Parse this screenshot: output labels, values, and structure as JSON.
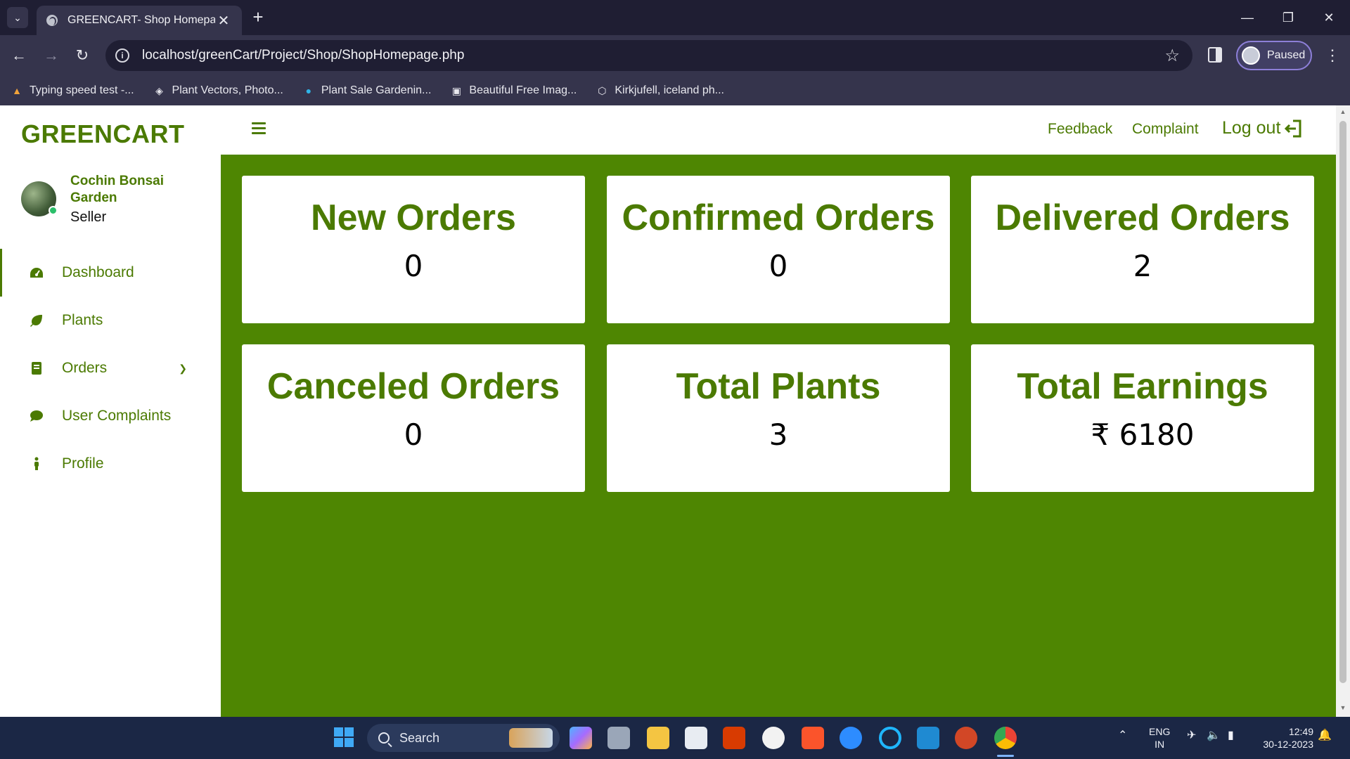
{
  "browser": {
    "tab_title": "GREENCART- Shop Homepage",
    "url": "localhost/greenCart/Project/Shop/ShopHomepage.php",
    "profile_label": "Paused",
    "bookmarks": [
      {
        "label": "Typing speed test -...",
        "icon": "typing-test-icon"
      },
      {
        "label": "Plant Vectors, Photo...",
        "icon": "freepik-icon"
      },
      {
        "label": "Plant Sale Gardenin...",
        "icon": "canva-icon"
      },
      {
        "label": "Beautiful Free Imag...",
        "icon": "unsplash-icon"
      },
      {
        "label": "Kirkjufell, iceland ph...",
        "icon": "pixabay-icon"
      }
    ]
  },
  "app": {
    "brand": "GREENCART",
    "user": {
      "shop_name": "Cochin Bonsai Garden",
      "role": "Seller"
    },
    "nav": [
      {
        "label": "Dashboard",
        "icon": "speedometer-icon",
        "active": true
      },
      {
        "label": "Plants",
        "icon": "leaf-icon"
      },
      {
        "label": "Orders",
        "icon": "receipt-icon",
        "has_submenu": true
      },
      {
        "label": "User Complaints",
        "icon": "chat-bubble-icon"
      },
      {
        "label": "Profile",
        "icon": "person-icon"
      }
    ],
    "topbar": {
      "feedback": "Feedback",
      "complaint": "Complaint",
      "logout": "Log out"
    },
    "cards": [
      {
        "title": "New Orders",
        "value": "0"
      },
      {
        "title": "Confirmed Orders",
        "value": "0"
      },
      {
        "title": "Delivered Orders",
        "value": "2"
      },
      {
        "title": "Canceled Orders",
        "value": "0"
      },
      {
        "title": "Total Plants",
        "value": "3"
      },
      {
        "title": "Total Earnings",
        "value": "₹ 6180"
      }
    ],
    "colors": {
      "brand_green": "#4b7a02",
      "content_bg": "#4e8602"
    }
  },
  "taskbar": {
    "search_label": "Search",
    "language": "ENG",
    "region": "IN",
    "time": "12:49",
    "date": "30-12-2023"
  }
}
